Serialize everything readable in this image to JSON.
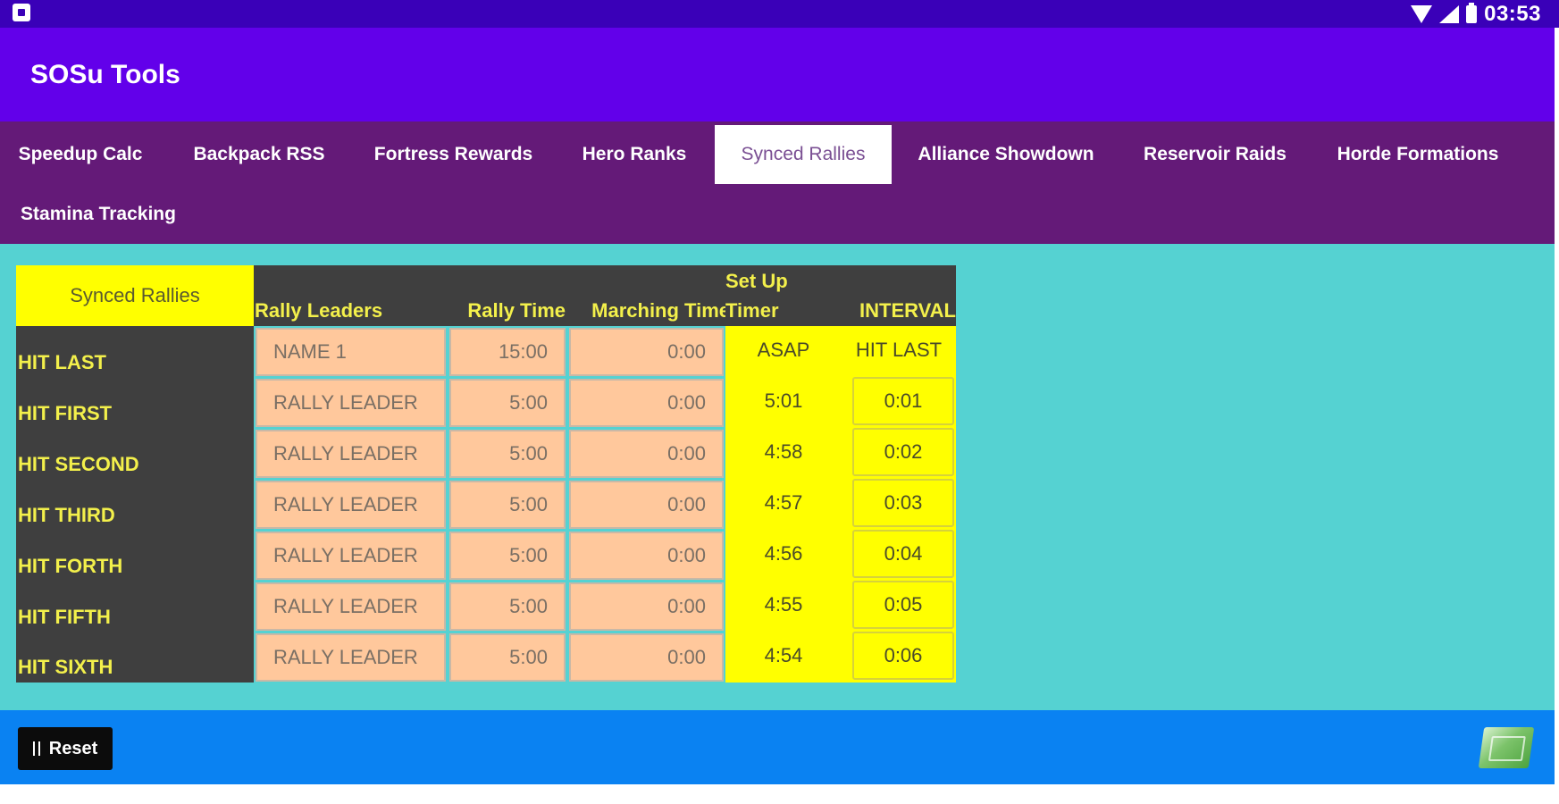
{
  "status": {
    "time": "03:53"
  },
  "app": {
    "title": "SOSu Tools"
  },
  "tabs": [
    {
      "label": "Speedup Calc",
      "selected": false
    },
    {
      "label": "Backpack RSS",
      "selected": false
    },
    {
      "label": "Fortress Rewards",
      "selected": false
    },
    {
      "label": "Hero Ranks",
      "selected": false
    },
    {
      "label": "Synced Rallies",
      "selected": true
    },
    {
      "label": "Alliance Showdown",
      "selected": false
    },
    {
      "label": "Reservoir Raids",
      "selected": false
    },
    {
      "label": "Horde Formations",
      "selected": false
    },
    {
      "label": "Stamina Tracking",
      "selected": false
    }
  ],
  "table": {
    "title": "Synced Rallies",
    "headers": {
      "leaders": "Rally Leaders",
      "rally_time": "Rally Time",
      "marching_time": "Marching Time",
      "setup_line1": "Set Up",
      "setup_line2": "Timer",
      "interval": "INTERVAL"
    },
    "rows": [
      {
        "label": "HIT LAST",
        "leader": "NAME 1",
        "rally_time": "15:00",
        "marching_time": "0:00",
        "setup": "ASAP",
        "interval": "HIT LAST"
      },
      {
        "label": "HIT FIRST",
        "leader": "RALLY LEADER",
        "rally_time": "5:00",
        "marching_time": "0:00",
        "setup": "5:01",
        "interval": "0:01"
      },
      {
        "label": "HIT SECOND",
        "leader": "RALLY LEADER",
        "rally_time": "5:00",
        "marching_time": "0:00",
        "setup": "4:58",
        "interval": "0:02"
      },
      {
        "label": "HIT THIRD",
        "leader": "RALLY LEADER",
        "rally_time": "5:00",
        "marching_time": "0:00",
        "setup": "4:57",
        "interval": "0:03"
      },
      {
        "label": "HIT FORTH",
        "leader": "RALLY LEADER",
        "rally_time": "5:00",
        "marching_time": "0:00",
        "setup": "4:56",
        "interval": "0:04"
      },
      {
        "label": "HIT FIFTH",
        "leader": "RALLY LEADER",
        "rally_time": "5:00",
        "marching_time": "0:00",
        "setup": "4:55",
        "interval": "0:05"
      },
      {
        "label": "HIT SIXTH",
        "leader": "RALLY LEADER",
        "rally_time": "5:00",
        "marching_time": "0:00",
        "setup": "4:54",
        "interval": "0:06"
      }
    ]
  },
  "bottom": {
    "reset_label": "Reset"
  },
  "icons": {
    "status_left": "notification-icon",
    "wifi": "wifi-icon",
    "signal": "signal-icon",
    "battery": "battery-icon",
    "reset": "reset-icon",
    "money": "money-icon"
  },
  "colors": {
    "statusbar": "#3a00b8",
    "appbar": "#6200ea",
    "tabbar": "#641a78",
    "content": "#55d2d2",
    "bottombar": "#0a82f2",
    "yellow": "#ffff00",
    "peach": "#ffc89c",
    "dark": "#3f3f3f"
  }
}
